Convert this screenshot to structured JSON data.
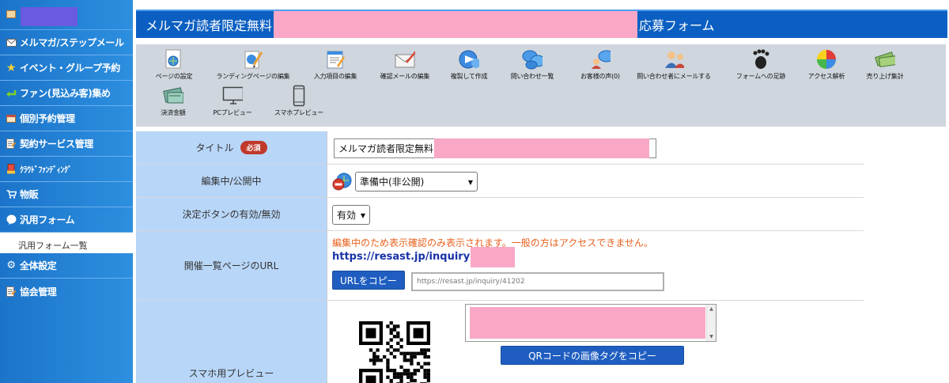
{
  "sidebar": {
    "items": [
      {
        "label": "メルマガ/ステップメール",
        "icon": "mail-icon"
      },
      {
        "label": "イベント・グループ予約",
        "icon": "star-icon"
      },
      {
        "label": "ファン(見込み客)集め",
        "icon": "arrow-icon"
      },
      {
        "label": "個別予約管理",
        "icon": "calendar-icon"
      },
      {
        "label": "契約サービス管理",
        "icon": "document-icon"
      },
      {
        "label": "ｸﾗｳﾄﾞﾌｧﾝﾃﾞｨﾝｸﾞ",
        "icon": "crowdfunding-icon"
      },
      {
        "label": "物販",
        "icon": "cart-icon"
      },
      {
        "label": "汎用フォーム",
        "icon": "bubble-icon"
      },
      {
        "label": "全体設定",
        "icon": "gear-icon"
      },
      {
        "label": "協会管理",
        "icon": "document-icon"
      }
    ],
    "sub_item": "汎用フォーム一覧"
  },
  "header": {
    "title_prefix": "メルマガ読者限定無料",
    "title_suffix": "応募フォーム"
  },
  "toolbar": {
    "tools": [
      {
        "label": "ページの設定",
        "icon": "page-settings-icon"
      },
      {
        "label": "ランディングページの編集",
        "icon": "landing-page-edit-icon"
      },
      {
        "label": "入力項目の編集",
        "icon": "input-items-edit-icon"
      },
      {
        "label": "確認メールの編集",
        "icon": "confirm-mail-edit-icon"
      },
      {
        "label": "複製して作成",
        "icon": "duplicate-icon"
      },
      {
        "label": "問い合わせ一覧",
        "icon": "inquiry-list-icon"
      },
      {
        "label": "お客様の声(0)",
        "icon": "customer-voice-icon"
      },
      {
        "label": "問い合わせ者にメールする",
        "icon": "mail-to-inquirer-icon"
      },
      {
        "label": "フォームへの足跡",
        "icon": "footprint-icon"
      },
      {
        "label": "アクセス解析",
        "icon": "access-analysis-icon"
      },
      {
        "label": "売り上げ集計",
        "icon": "sales-summary-icon"
      },
      {
        "label": "決済金額",
        "icon": "payment-amount-icon"
      },
      {
        "label": "PCプレビュー",
        "icon": "pc-preview-icon"
      },
      {
        "label": "スマホプレビュー",
        "icon": "smartphone-preview-icon"
      }
    ]
  },
  "form": {
    "title_label": "タイトル",
    "required_badge": "必須",
    "title_value": "メルマガ読者限定無料",
    "status_label": "編集中/公開中",
    "status_value": "準備中(非公開)",
    "button_label": "決定ボタンの有効/無効",
    "button_value": "有効",
    "url_label": "開催一覧ページのURL",
    "url_warning": "編集中のため表示確認のみ表示されます。一般の方はアクセスできません。",
    "url_text": "https://resast.jp/inquiry",
    "copy_url_button": "URLをコピー",
    "url_field_value": "https://resast.jp/inquiry/41202",
    "preview_label": "スマホ用プレビュー",
    "qr_copy_button": "QRコードの画像タグをコピー"
  },
  "colors": {
    "sidebar": "#2584d8",
    "header": "#0c5fc2",
    "label_bg": "#b8d6f8",
    "redaction": "#f8a8c6",
    "warning": "#e8601c",
    "url": "#1732a8",
    "button": "#1f5ec0"
  }
}
